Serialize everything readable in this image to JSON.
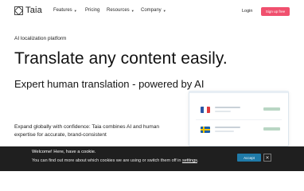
{
  "brand": {
    "logo_icon": "taia-logo-icon",
    "name": "Taia"
  },
  "nav": {
    "items": [
      {
        "label": "Features",
        "has_dropdown": true
      },
      {
        "label": "Pricing",
        "has_dropdown": false
      },
      {
        "label": "Resources",
        "has_dropdown": true
      },
      {
        "label": "Company",
        "has_dropdown": true
      }
    ],
    "login_label": "Login",
    "signup_label": "Sign up free"
  },
  "hero": {
    "eyebrow": "AI localization platform",
    "headline": "Translate any content easily.",
    "subheadline": "Expert human translation - powered by AI",
    "body": "Expand globally with confidence: Taia combines AI and human expertise for accurate, brand-consistent"
  },
  "preview_card": {
    "rows": [
      {
        "flag": "france-flag-icon"
      },
      {
        "flag": "sweden-flag-icon"
      }
    ]
  },
  "cookie_banner": {
    "title": "Welcome! Here, have a cookie.",
    "text": "You can find out more about which cookies we are using or switch them off in",
    "link": "settings",
    "suffix": ".",
    "accept_label": "Accept",
    "close_icon": "close-icon"
  },
  "colors": {
    "accent": "#f0506e",
    "banner_bg": "#1f1f1f",
    "accept_button": "#1f7aa8"
  }
}
